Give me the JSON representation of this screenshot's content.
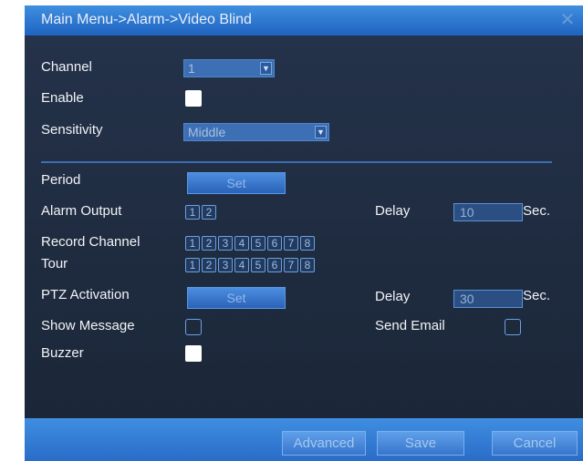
{
  "window": {
    "title": "Main Menu->Alarm->Video Blind",
    "close_icon": "close-icon"
  },
  "form": {
    "channel": {
      "label": "Channel",
      "value": "1"
    },
    "enable": {
      "label": "Enable",
      "checked": true
    },
    "sensitivity": {
      "label": "Sensitivity",
      "value": "Middle"
    },
    "period": {
      "label": "Period",
      "button": "Set"
    },
    "alarm_output": {
      "label": "Alarm Output",
      "items": [
        "1",
        "2"
      ]
    },
    "alarm_delay": {
      "label": "Delay",
      "value": "10",
      "unit": "Sec."
    },
    "record_channel": {
      "label": "Record Channel",
      "items": [
        "1",
        "2",
        "3",
        "4",
        "5",
        "6",
        "7",
        "8"
      ]
    },
    "tour": {
      "label": "Tour",
      "items": [
        "1",
        "2",
        "3",
        "4",
        "5",
        "6",
        "7",
        "8"
      ]
    },
    "ptz": {
      "label": "PTZ Activation",
      "button": "Set"
    },
    "ptz_delay": {
      "label": "Delay",
      "value": "30",
      "unit": "Sec."
    },
    "show_message": {
      "label": "Show Message",
      "checked": false
    },
    "send_email": {
      "label": "Send Email",
      "checked": false
    },
    "buzzer": {
      "label": "Buzzer",
      "checked": true
    }
  },
  "footer": {
    "advanced": "Advanced",
    "save": "Save",
    "cancel": "Cancel"
  },
  "colors": {
    "titlebar": "#2f78d2",
    "panel": "#1f2c3e",
    "accent": "#4c8ee0"
  }
}
